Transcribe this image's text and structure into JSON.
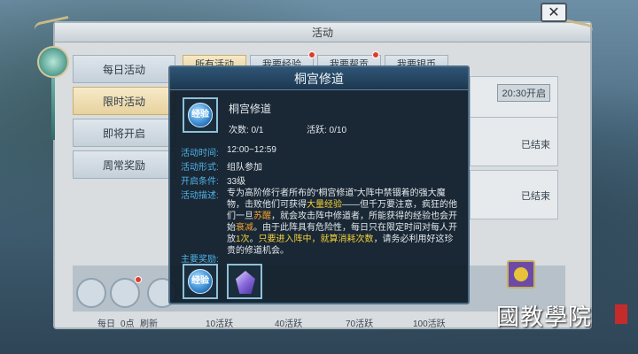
{
  "window": {
    "title": "活动",
    "close_glyph": "✕"
  },
  "sidebar": {
    "items": [
      {
        "label": "每日活动",
        "active": false
      },
      {
        "label": "限时活动",
        "active": true
      },
      {
        "label": "即将开启",
        "active": false
      },
      {
        "label": "周常奖励",
        "active": false
      }
    ]
  },
  "top_tabs": [
    {
      "label": "所有活动",
      "active": true
    },
    {
      "label": "我要经验",
      "active": false,
      "dot": true
    },
    {
      "label": "我要帮贡",
      "active": false,
      "dot": true
    },
    {
      "label": "我要银币",
      "active": false
    }
  ],
  "list": [
    {
      "status": "20:30开启"
    },
    {
      "status": "已结束"
    },
    {
      "status": "已结束"
    }
  ],
  "bottom": {
    "labels": [
      "每日",
      "0点",
      "刷新",
      "10活跃",
      "40活跃",
      "70活跃",
      "100活跃"
    ]
  },
  "popup": {
    "title": "桐宫修道",
    "icon_text": "经验",
    "name": "桐宫修道",
    "count": "次数: 0/1",
    "activity": "活跃: 0/10",
    "rows": [
      {
        "label": "活动时间:",
        "value": "12:00~12:59"
      },
      {
        "label": "活动形式:",
        "value": "组队参加"
      },
      {
        "label": "开启条件:",
        "value": "33级"
      },
      {
        "label": "活动描述:",
        "value": ""
      }
    ],
    "desc_parts": [
      "专为高阶修行者所布的“桐宫修道”大阵中禁锢着的强大魔物，击败他们可获得",
      "大量经验",
      "——但千万要注意，疯狂的他们一旦",
      "苏醒",
      "，就会攻击阵中修道者，所能获得的经验也会开始",
      "衰减",
      "。由于此阵具有危险性，每日只在限定时间对每人开放",
      "1次",
      "。",
      "只要进入阵中，就算消耗次数",
      "，请务必利用好这珍贵的修道机会。"
    ],
    "rewards_label": "主要奖励:",
    "reward_icon_text": "经验"
  },
  "watermark": {
    "text": "國教學院"
  },
  "colors": {
    "accent_blue": "#4fb3e6",
    "highlight_yellow": "#f2d23a",
    "highlight_orange": "#f0a030"
  }
}
